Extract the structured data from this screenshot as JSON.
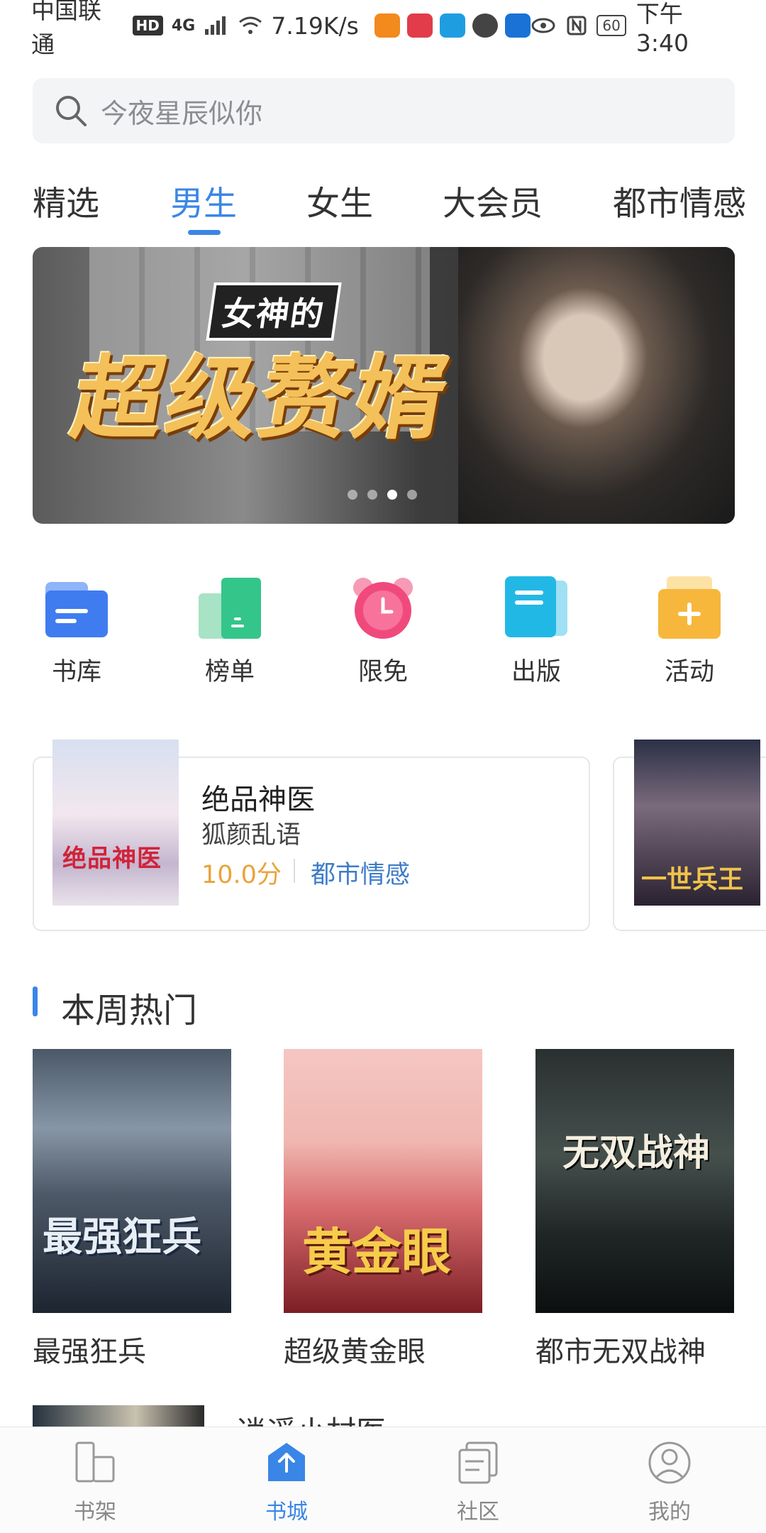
{
  "status_bar": {
    "carrier": "中国联通",
    "hd": "HD",
    "network": "4G",
    "speed": "7.19K/s",
    "battery": "60",
    "time": "下午3:40"
  },
  "search": {
    "placeholder": "今夜星辰似你"
  },
  "tabs": [
    {
      "label": "精选",
      "active": false
    },
    {
      "label": "男生",
      "active": true
    },
    {
      "label": "女生",
      "active": false
    },
    {
      "label": "大会员",
      "active": false
    },
    {
      "label": "都市情感",
      "active": false
    }
  ],
  "banner": {
    "small_title": "女神的",
    "big_title": "超级赘婿",
    "total_pages": 4,
    "current_page": 3
  },
  "quick_entries": [
    {
      "label": "书库",
      "icon": "bookshelf-folder-icon",
      "color": "#3f7cf0"
    },
    {
      "label": "榜单",
      "icon": "ranking-icon",
      "color": "#34c58a"
    },
    {
      "label": "限免",
      "icon": "alarm-clock-icon",
      "color": "#f04a7d"
    },
    {
      "label": "出版",
      "icon": "publish-book-icon",
      "color": "#22b8e6"
    },
    {
      "label": "活动",
      "icon": "activity-plus-icon",
      "color": "#f6b73c"
    }
  ],
  "featured_book": {
    "cover_title": "绝品神医",
    "title": "绝品神医",
    "author": "狐颜乱语",
    "score": "10.0分",
    "genre": "都市情感"
  },
  "featured_book_2": {
    "cover_title": "一世兵王"
  },
  "hot_section": {
    "title": "本周热门",
    "books": [
      {
        "title": "最强狂兵",
        "cover_text": "最强狂兵"
      },
      {
        "title": "超级黄金眼",
        "cover_text": "黄金眼"
      },
      {
        "title": "都市无双战神",
        "cover_text": "无双战神"
      }
    ],
    "next_title_partial": "逍遥小村医"
  },
  "bottom_nav": [
    {
      "label": "书架",
      "icon": "bookshelf-icon",
      "active": false
    },
    {
      "label": "书城",
      "icon": "bookstore-icon",
      "active": true
    },
    {
      "label": "社区",
      "icon": "community-icon",
      "active": false
    },
    {
      "label": "我的",
      "icon": "profile-icon",
      "active": false
    }
  ],
  "colors": {
    "accent": "#3a86e6",
    "score": "#e8a43c",
    "genre": "#3f7cc9"
  }
}
